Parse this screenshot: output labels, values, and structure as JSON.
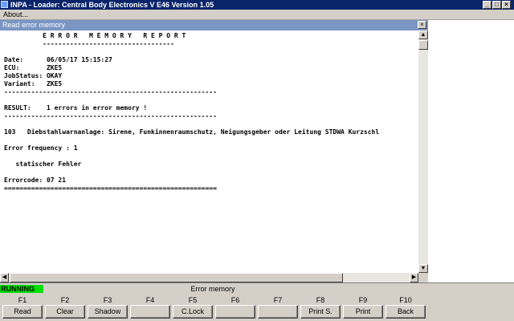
{
  "window": {
    "title": "INPA - Loader:  Central Body Electronics V E46 Version 1.05",
    "min_glyph": "_",
    "max_glyph": "□",
    "close_glyph": "×"
  },
  "menu": {
    "about_label": "About..."
  },
  "child_window": {
    "title": "Read error memory",
    "close_glyph": "×"
  },
  "report": {
    "lines": [
      "          E R R O R   M E M O R Y   R E P O R T",
      "          ----------------------------------",
      "",
      "Date:      06/05/17 15:15:27",
      "ECU:       ZKE5",
      "JobStatus: OKAY",
      "Variant:   ZKE5",
      "-------------------------------------------------------",
      "",
      "RESULT:    1 errors in error memory !",
      "-------------------------------------------------------",
      "",
      "103   Diebstahlwarnanlage: Sirene, Funkinnenraumschutz, Neigungsgeber oder Leitung STDWA Kurzschl",
      "",
      "Error frequency : 1",
      "",
      "   statischer Fehler",
      "",
      "Errorcode: 07 21",
      "======================================================="
    ]
  },
  "status": {
    "running": "RUNNING",
    "title": "Error memory",
    "running_color": "#00e000"
  },
  "function_keys": [
    {
      "key": "F1",
      "label": "Read"
    },
    {
      "key": "F2",
      "label": "Clear"
    },
    {
      "key": "F3",
      "label": "Shadow"
    },
    {
      "key": "F4",
      "label": ""
    },
    {
      "key": "F5",
      "label": "C.Lock"
    },
    {
      "key": "F6",
      "label": ""
    },
    {
      "key": "F7",
      "label": ""
    },
    {
      "key": "F8",
      "label": "Print S."
    },
    {
      "key": "F9",
      "label": "Print"
    },
    {
      "key": "F10",
      "label": "Back"
    }
  ],
  "colors": {
    "titlebar": "#0a246a",
    "child_titlebar": "#7b96c4",
    "chrome": "#d4d0c8"
  }
}
